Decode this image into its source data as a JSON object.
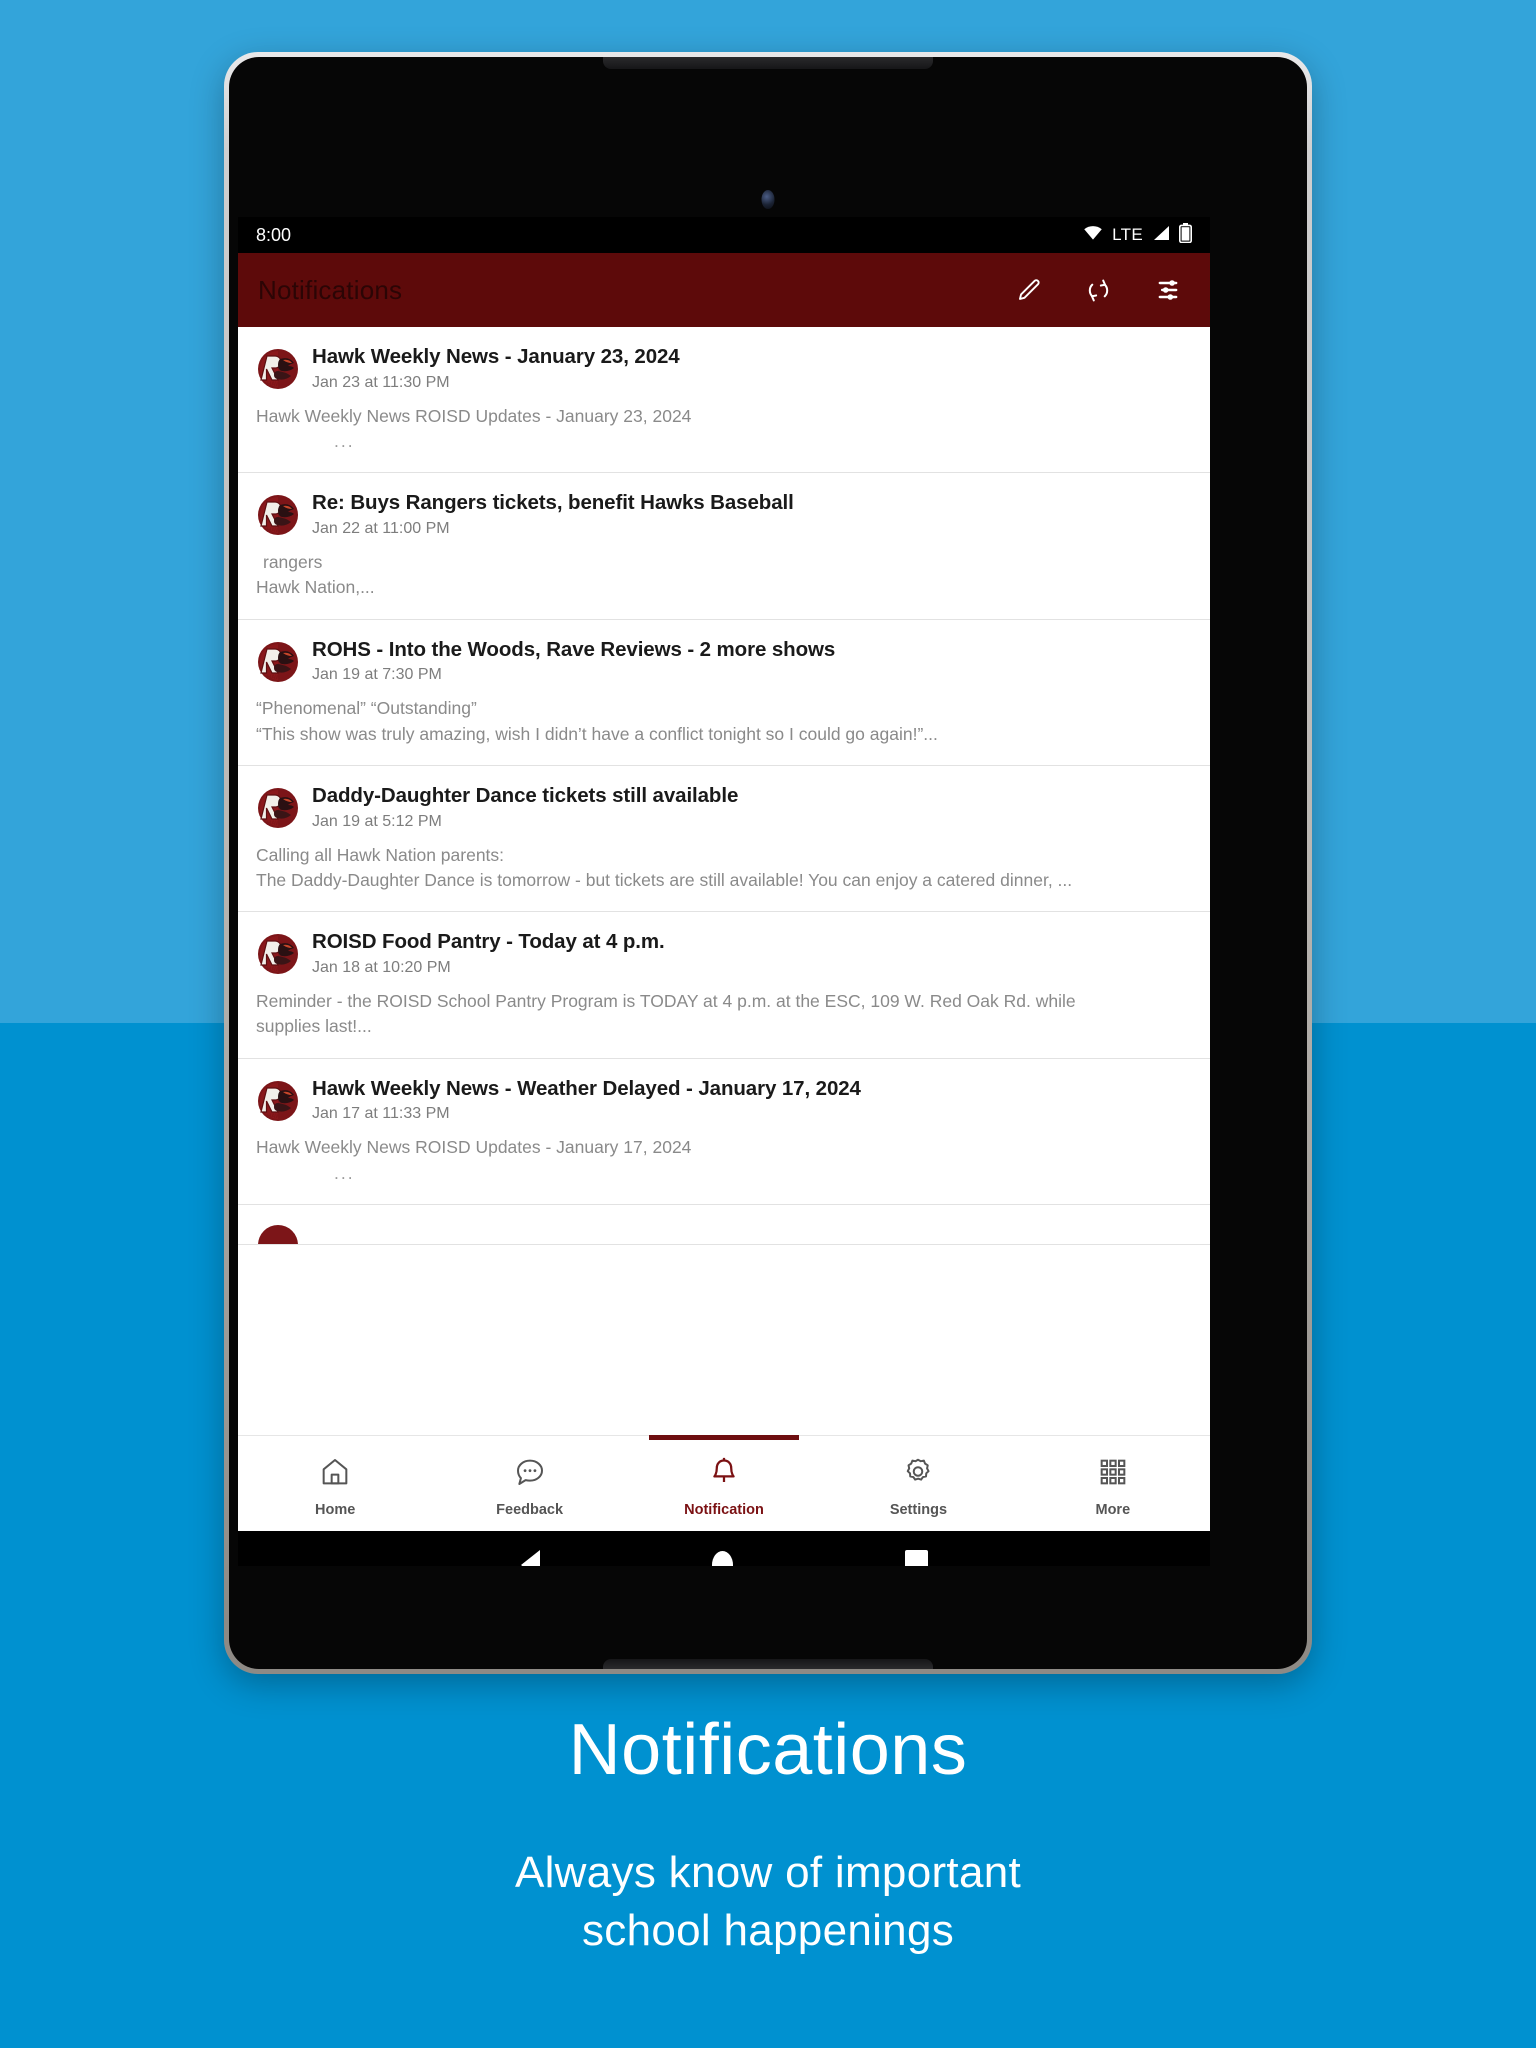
{
  "theme": {
    "bg_top": "#33a4da",
    "bg_bottom": "#0091d0",
    "appbar": "#5d0a0a",
    "accent": "#7b1113"
  },
  "status_bar": {
    "time": "8:00",
    "network_label": "LTE",
    "icons": [
      "wifi-icon",
      "signal-icon",
      "battery-icon"
    ]
  },
  "app_bar": {
    "title": "Notifications",
    "actions": [
      {
        "name": "compose-button",
        "icon": "pencil-icon"
      },
      {
        "name": "refresh-button",
        "icon": "refresh-icon"
      },
      {
        "name": "filter-button",
        "icon": "tune-icon"
      }
    ]
  },
  "notifications": [
    {
      "title": "Hawk Weekly News - January 23, 2024",
      "date": "Jan 23 at 11:30 PM",
      "line1": "Hawk Weekly News ROISD Updates - January 23, 2024",
      "line2": "..."
    },
    {
      "title": "Re: Buys Rangers tickets, benefit Hawks Baseball",
      "date": "Jan 22 at 11:00 PM",
      "line1": "rangers",
      "line2": "Hawk Nation,..."
    },
    {
      "title": "ROHS - Into the Woods, Rave Reviews - 2 more shows",
      "date": "Jan 19 at 7:30 PM",
      "line1": "“Phenomenal”  “Outstanding”",
      "line2": "“This show was truly amazing, wish I didn’t have a conflict tonight so I could go again!”..."
    },
    {
      "title": "Daddy-Daughter Dance tickets still available",
      "date": "Jan 19 at 5:12 PM",
      "line1": "Calling all Hawk Nation parents:",
      "line2": "The Daddy-Daughter Dance is tomorrow - but tickets are still available! You can enjoy a catered dinner, ..."
    },
    {
      "title": "ROISD Food Pantry - Today at 4 p.m.",
      "date": "Jan 18 at 10:20 PM",
      "line1": "Reminder - the ROISD School Pantry Program is TODAY at 4 p.m. at the ESC, 109 W. Red Oak Rd. while",
      "line2": "supplies last!..."
    },
    {
      "title": "Hawk Weekly News - Weather Delayed - January 17, 2024",
      "date": "Jan 17 at 11:33 PM",
      "line1": "Hawk Weekly News ROISD Updates - January 17, 2024",
      "line2": "..."
    }
  ],
  "bottom_nav": [
    {
      "label": "Home",
      "icon": "home-icon",
      "active": false
    },
    {
      "label": "Feedback",
      "icon": "chat-bubble-icon",
      "active": false
    },
    {
      "label": "Notification",
      "icon": "bell-icon",
      "active": true
    },
    {
      "label": "Settings",
      "icon": "gear-icon",
      "active": false
    },
    {
      "label": "More",
      "icon": "grid-icon",
      "active": false
    }
  ],
  "android_nav": [
    {
      "name": "back-button",
      "icon": "triangle-back-icon"
    },
    {
      "name": "home-button",
      "icon": "circle-home-icon"
    },
    {
      "name": "recents-button",
      "icon": "square-recents-icon"
    }
  ],
  "caption": {
    "title": "Notifications",
    "subtitle_line1": "Always know of important",
    "subtitle_line2": "school happenings"
  }
}
